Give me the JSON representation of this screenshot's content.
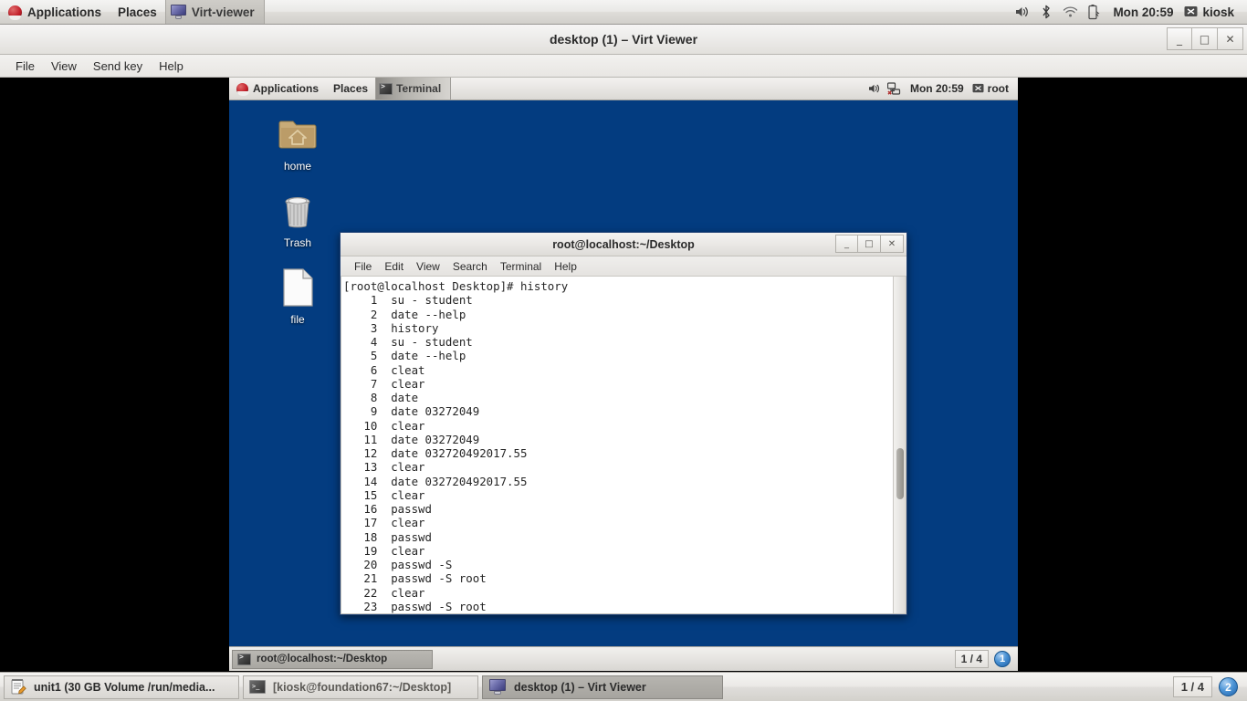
{
  "host_panel": {
    "applications": "Applications",
    "places": "Places",
    "window_button": "Virt-viewer",
    "clock": "Mon 20:59",
    "user": "kiosk",
    "icons": [
      "redhat-icon",
      "volume-icon",
      "bluetooth-icon",
      "wifi-icon",
      "battery-icon",
      "user-icon"
    ]
  },
  "virt_viewer": {
    "title": "desktop (1) – Virt Viewer",
    "menus": [
      "File",
      "View",
      "Send key",
      "Help"
    ],
    "window_buttons": [
      "minimize",
      "maximize",
      "close"
    ]
  },
  "guest": {
    "panel": {
      "applications": "Applications",
      "places": "Places",
      "window_button": "Terminal",
      "clock": "Mon 20:59",
      "user": "root"
    },
    "desktop_icons": [
      {
        "label": "home",
        "icon": "folder-home-icon"
      },
      {
        "label": "Trash",
        "icon": "trash-icon"
      },
      {
        "label": "file",
        "icon": "document-icon"
      }
    ],
    "taskbar": {
      "window_label": "root@localhost:~/Desktop",
      "workspace_label": "1 / 4",
      "workspace_number": "1"
    },
    "background_color": "#033c80"
  },
  "terminal": {
    "title": "root@localhost:~/Desktop",
    "menus": [
      "File",
      "Edit",
      "View",
      "Search",
      "Terminal",
      "Help"
    ],
    "window_buttons": [
      "minimize",
      "maximize",
      "close"
    ],
    "prompt_line": "[root@localhost Desktop]# history",
    "history": [
      {
        "n": "1",
        "cmd": "su - student"
      },
      {
        "n": "2",
        "cmd": "date --help"
      },
      {
        "n": "3",
        "cmd": "history"
      },
      {
        "n": "4",
        "cmd": "su - student"
      },
      {
        "n": "5",
        "cmd": "date --help"
      },
      {
        "n": "6",
        "cmd": "cleat"
      },
      {
        "n": "7",
        "cmd": "clear"
      },
      {
        "n": "8",
        "cmd": "date"
      },
      {
        "n": "9",
        "cmd": "date 03272049"
      },
      {
        "n": "10",
        "cmd": "clear"
      },
      {
        "n": "11",
        "cmd": "date 03272049"
      },
      {
        "n": "12",
        "cmd": "date 032720492017.55"
      },
      {
        "n": "13",
        "cmd": "clear"
      },
      {
        "n": "14",
        "cmd": "date 032720492017.55"
      },
      {
        "n": "15",
        "cmd": "clear"
      },
      {
        "n": "16",
        "cmd": "passwd"
      },
      {
        "n": "17",
        "cmd": "clear"
      },
      {
        "n": "18",
        "cmd": "passwd"
      },
      {
        "n": "19",
        "cmd": "clear"
      },
      {
        "n": "20",
        "cmd": "passwd -S"
      },
      {
        "n": "21",
        "cmd": "passwd -S root"
      },
      {
        "n": "22",
        "cmd": "clear"
      },
      {
        "n": "23",
        "cmd": "passwd -S root"
      }
    ]
  },
  "host_taskbar": {
    "items": [
      {
        "label": "unit1 (30 GB Volume /run/media...",
        "icon": "gedit-icon",
        "active": false
      },
      {
        "label": "[kiosk@foundation67:~/Desktop]",
        "icon": "terminal-icon",
        "active": false
      },
      {
        "label": "desktop (1) – Virt Viewer",
        "icon": "monitor-icon",
        "active": true
      }
    ],
    "workspace_label": "1 / 4",
    "workspace_number": "2"
  }
}
